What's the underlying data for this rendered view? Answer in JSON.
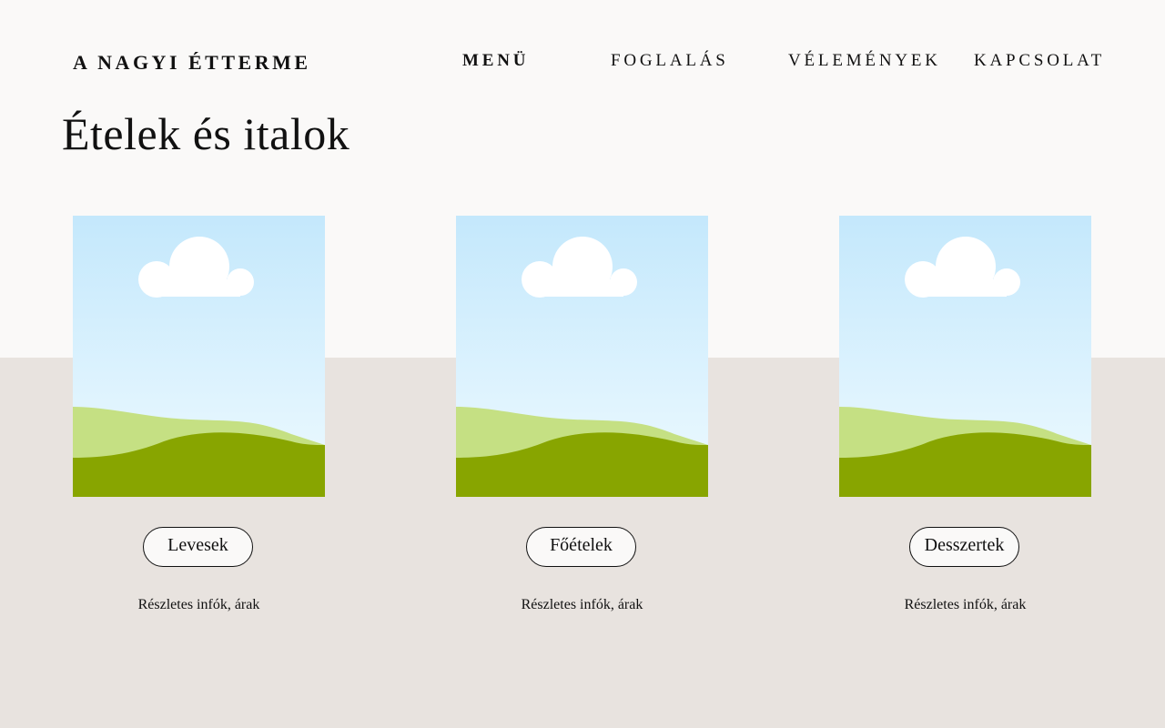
{
  "brand": {
    "name": "A NAGYI ÉTTERME"
  },
  "nav": {
    "items": [
      {
        "label": "MENÜ",
        "active": true
      },
      {
        "label": "FOGLALÁS",
        "active": false
      },
      {
        "label": "VÉLEMÉNYEK",
        "active": false
      },
      {
        "label": "KAPCSOLAT",
        "active": false
      }
    ]
  },
  "page": {
    "title": "Ételek és italok"
  },
  "cards": [
    {
      "button_label": "Levesek",
      "info_label": "Részletes infók, árak",
      "image_icon": "landscape-placeholder-icon"
    },
    {
      "button_label": "Főételek",
      "info_label": "Részletes infók, árak",
      "image_icon": "landscape-placeholder-icon"
    },
    {
      "button_label": "Desszertek",
      "info_label": "Részletes infók, árak",
      "image_icon": "landscape-placeholder-icon"
    }
  ],
  "colors": {
    "page_bg": "#faf9f8",
    "band_bg": "#e8e3df",
    "sky_top": "#c4e8fc",
    "sky_bottom": "#eefaff",
    "hill_light": "#c5e083",
    "hill_dark": "#88a500",
    "cloud": "#ffffff"
  }
}
